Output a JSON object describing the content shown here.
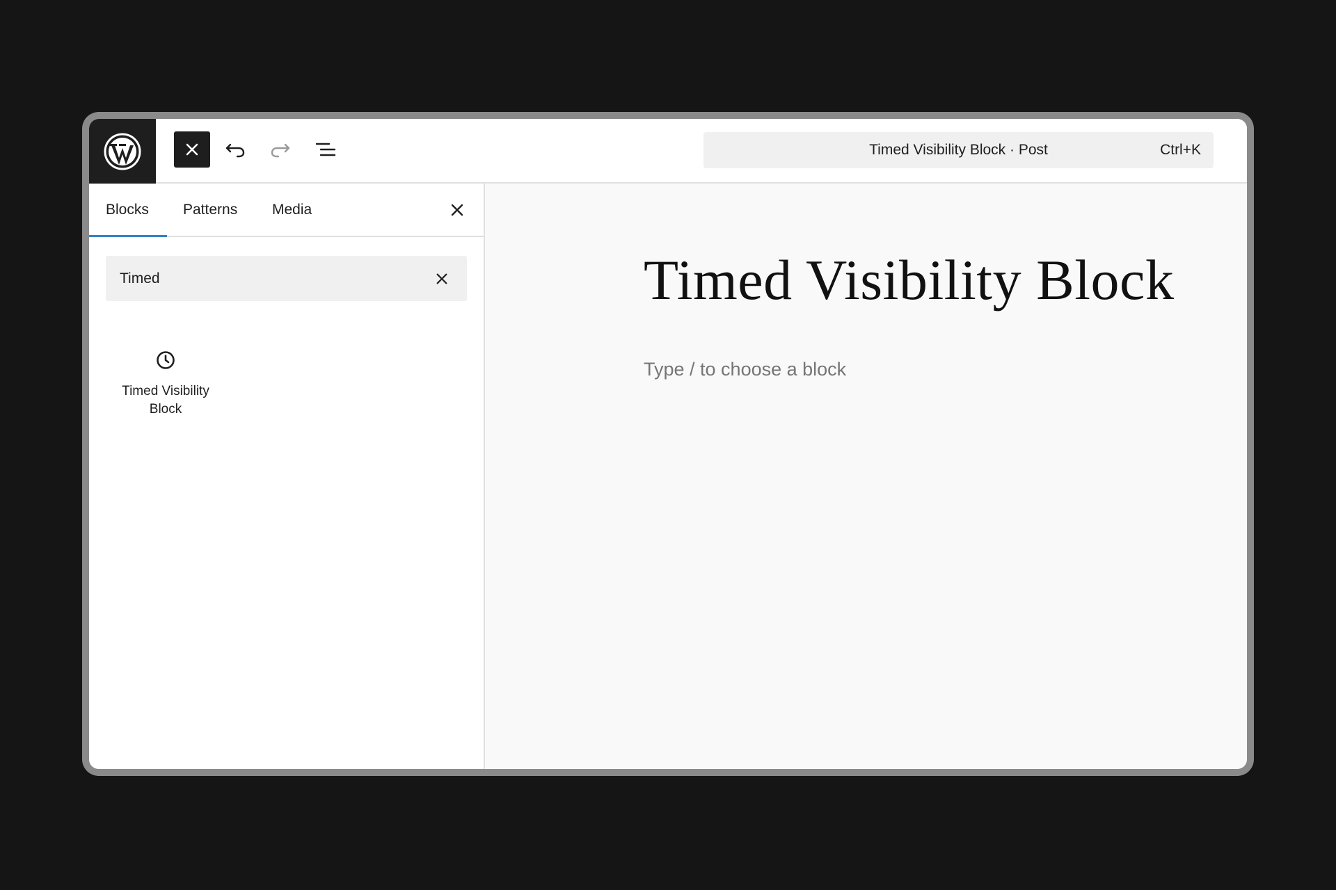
{
  "topbar": {
    "logo_icon": "wordpress-logo-icon",
    "close_inserter_icon": "close-icon",
    "undo_icon": "undo-icon",
    "redo_icon": "redo-icon",
    "document_overview_icon": "list-view-icon",
    "command_bar": {
      "title": "Timed Visibility Block · Post",
      "shortcut": "Ctrl+K"
    }
  },
  "inserter": {
    "tabs": [
      {
        "label": "Blocks",
        "active": true
      },
      {
        "label": "Patterns",
        "active": false
      },
      {
        "label": "Media",
        "active": false
      }
    ],
    "close_icon": "close-icon",
    "search": {
      "value": "Timed",
      "clear_icon": "close-icon"
    },
    "results": [
      {
        "icon": "clock-icon",
        "label": "Timed Visibility Block"
      }
    ]
  },
  "editor": {
    "post_title": "Timed Visibility Block",
    "block_placeholder": "Type / to choose a block"
  },
  "colors": {
    "page_background": "#151515",
    "topbar_dark": "#1e1e1e",
    "active_tab_underline": "#3582c4",
    "canvas_background": "#f9f9f9"
  }
}
